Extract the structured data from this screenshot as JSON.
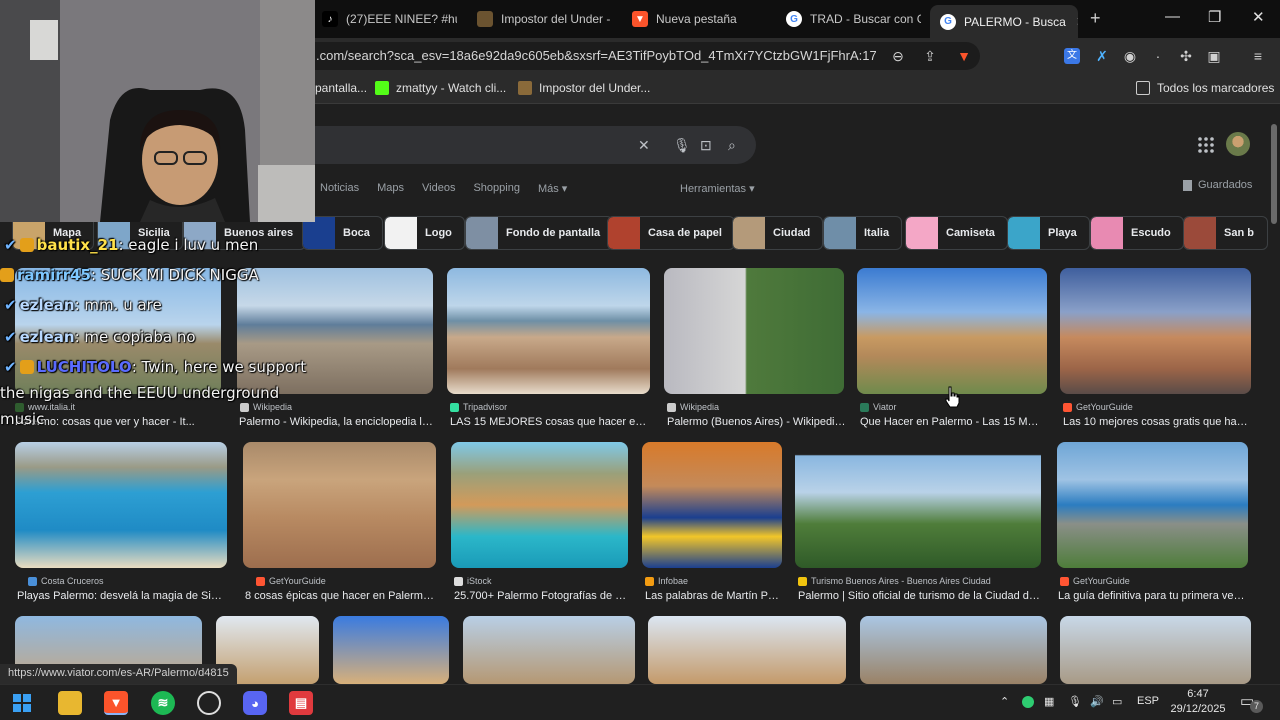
{
  "tabs": [
    {
      "label": "(27)EEE NINEE? #hum",
      "icon": "tiktok-icon"
    },
    {
      "label": "Impostor del Under -",
      "icon": "game-icon"
    },
    {
      "label": "Nueva pestaña",
      "icon": "brave-icon"
    },
    {
      "label": "TRAD - Buscar con Go",
      "icon": "google-icon"
    },
    {
      "label": "PALERMO - Busca",
      "icon": "google-icon",
      "active": true
    }
  ],
  "window_controls": {
    "new_tab": "+",
    "minimize": "—",
    "restore": "❐",
    "close": "✕"
  },
  "address": {
    "url": ".com/search?sca_esv=18a6e92da9c605eb&sxsrf=AE3TifPoybTOd_4TmXr7YCtzbGW1FjFhrA:176..."
  },
  "bookmarks": [
    {
      "label": "pantalla...",
      "color": "#444444"
    },
    {
      "label": "zmattyy - Watch cli...",
      "color": "#53fc18"
    },
    {
      "label": "Impostor del Under...",
      "color": "#8a6a3a"
    }
  ],
  "all_bookmarks": "Todos los marcadores",
  "filters": [
    "Noticias",
    "Maps",
    "Videos",
    "Shopping",
    "Más ▾"
  ],
  "tools_label": "Herramientas ▾",
  "saved_label": "Guardados",
  "chips": [
    {
      "label": "Mapa",
      "color": "#c9a46a"
    },
    {
      "label": "Sicilia",
      "color": "#7ea6c9"
    },
    {
      "label": "Buenos aires",
      "color": "#8da8c6"
    },
    {
      "label": "Boca",
      "color": "#1a3f8f"
    },
    {
      "label": "Logo",
      "color": "#f2f2f2"
    },
    {
      "label": "Fondo de pantalla",
      "color": "#7e8fa3"
    },
    {
      "label": "Casa de papel",
      "color": "#b0422e"
    },
    {
      "label": "Ciudad",
      "color": "#b49a7a"
    },
    {
      "label": "Italia",
      "color": "#6f8ea8"
    },
    {
      "label": "Camiseta",
      "color": "#f4a7c6"
    },
    {
      "label": "Playa",
      "color": "#3ba5c9"
    },
    {
      "label": "Escudo",
      "color": "#e88ab2"
    },
    {
      "label": "San b",
      "color": "#9b4a3a"
    }
  ],
  "results": [
    {
      "source": "www.italia.it",
      "title": "Palermo: cosas que ver y hacer - It...",
      "color": "#2f5d2f"
    },
    {
      "source": "Wikipedia",
      "title": "Palermo - Wikipedia, la enciclopedia libre",
      "color": "#cccccc"
    },
    {
      "source": "Tripadvisor",
      "title": "LAS 15 MEJORES cosas que hacer en P...",
      "color": "#34e0a1"
    },
    {
      "source": "Wikipedia",
      "title": "Palermo (Buenos Aires) - Wikipedia,...",
      "color": "#cccccc"
    },
    {
      "source": "Viator",
      "title": "Que Hacer en Palermo - Las 15 MEJ...",
      "color": "#2a7a5a"
    },
    {
      "source": "GetYourGuide",
      "title": "Las 10 mejores cosas gratis que hace...",
      "color": "#ff5533"
    },
    {
      "source": "Costa Cruceros",
      "title": "Playas Palermo: desvelá la magia de Sicilia...",
      "color": "#4a90d9"
    },
    {
      "source": "GetYourGuide",
      "title": "8 cosas épicas que hacer en Palermo e...",
      "color": "#ff5533"
    },
    {
      "source": "iStock",
      "title": "25.700+ Palermo Fotografías de st...",
      "color": "#dddddd"
    },
    {
      "source": "Infobae",
      "title": "Las palabras de Martín Pal...",
      "color": "#f39c12"
    },
    {
      "source": "Turismo Buenos Aires - Buenos Aires Ciudad",
      "title": "Palermo | Sitio oficial de turismo de la Ciudad de B...",
      "color": "#f1c40f"
    },
    {
      "source": "GetYourGuide",
      "title": "La guía definitiva para tu primera vez e...",
      "color": "#ff5533"
    }
  ],
  "status_url": "https://www.viator.com/es-AR/Palermo/d4815",
  "chat": [
    {
      "user": "bautix_21",
      "message": ": eagle i luv u men",
      "user_color": "#ffe14a"
    },
    {
      "user": "ramirr45",
      "message": ": SUCK MI DICK NIGGA",
      "user_color": "#7ec8ff"
    },
    {
      "user": "ezlean",
      "message": ": mm. u are",
      "user_color": "#b9d9ff"
    },
    {
      "user": "ezlean",
      "message": ": me copiaba no",
      "user_color": "#b9d9ff"
    },
    {
      "user": "LUCHITOLO",
      "message": ": Twin, here we support",
      "user_color": "#5a6bff"
    }
  ],
  "chat_wrap": [
    "the nigas and the EEUU underground",
    "music"
  ],
  "taskbar": {
    "language": "ESP",
    "time": "6:47",
    "date": "29/12/2025",
    "notifications": "7"
  }
}
